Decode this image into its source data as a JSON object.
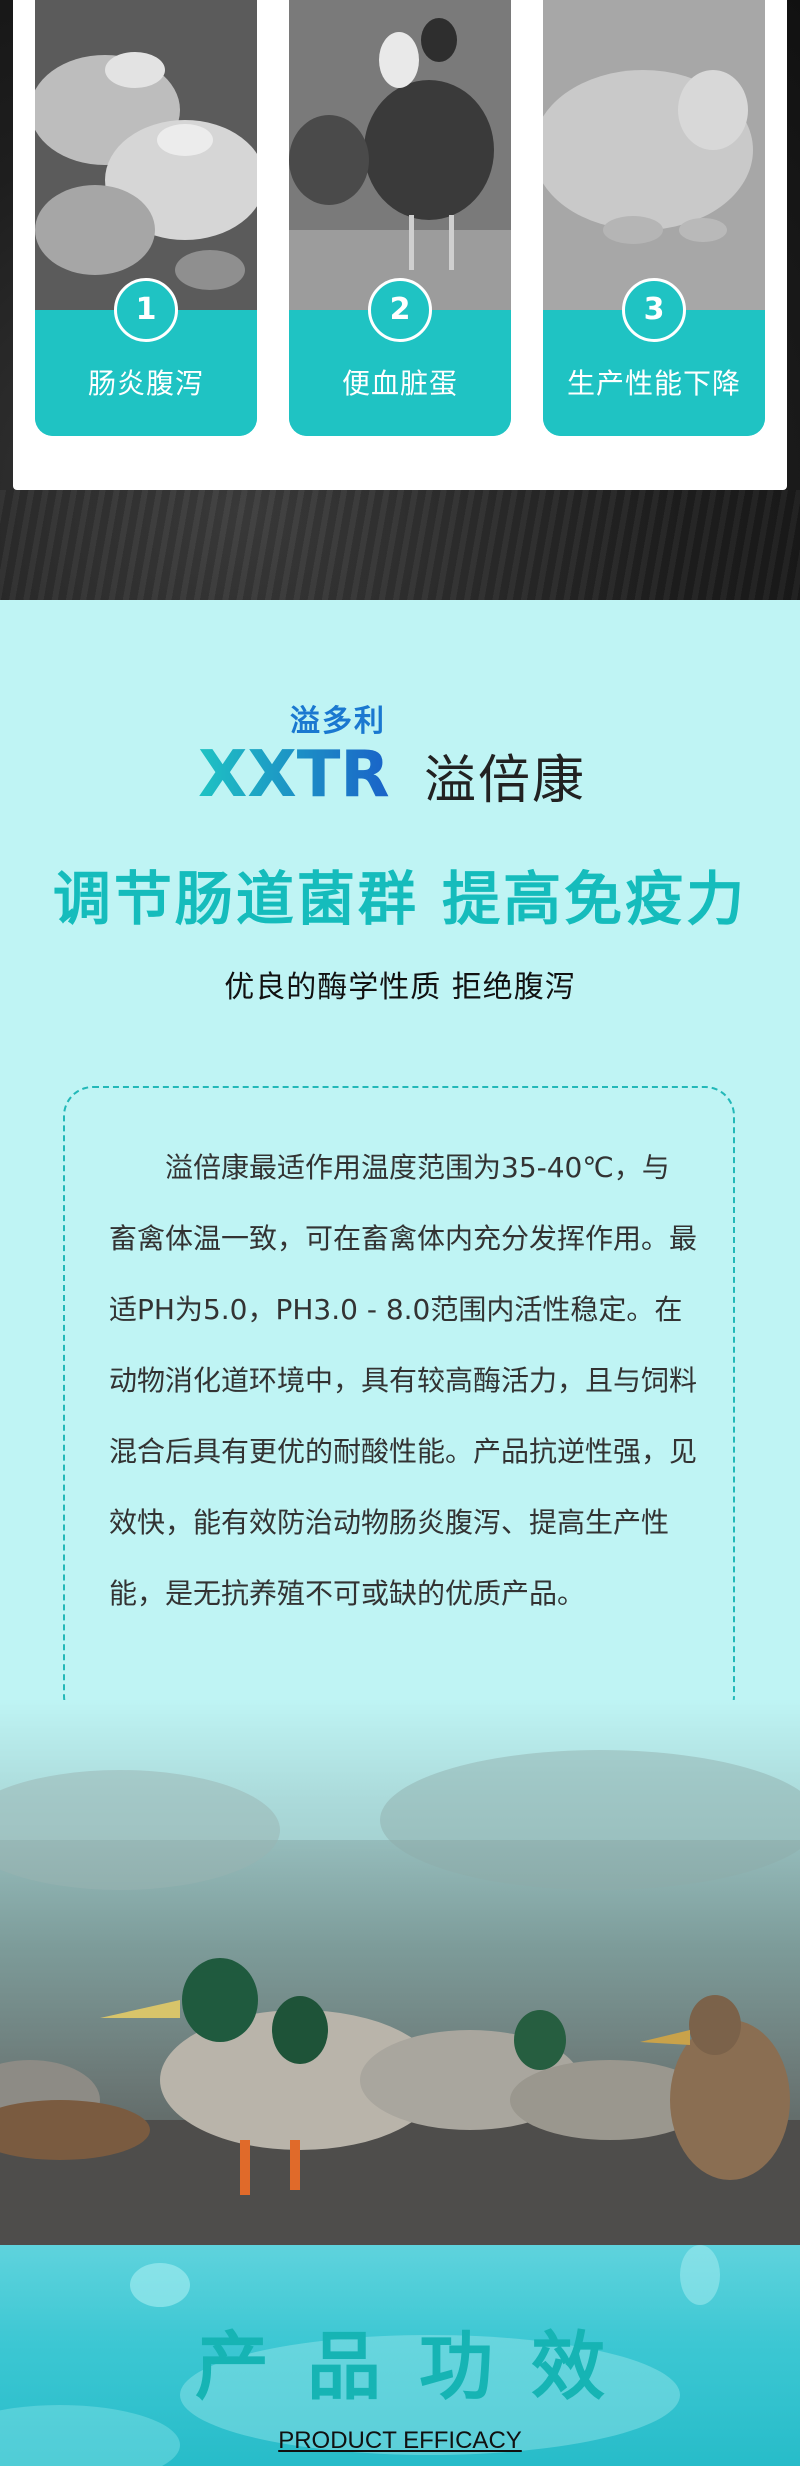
{
  "symptoms": [
    {
      "number": "1",
      "label": "肠炎腹泻",
      "photo": "piglets-photo"
    },
    {
      "number": "2",
      "label": "便血脏蛋",
      "photo": "hens-photo"
    },
    {
      "number": "3",
      "label": "生产性能下降",
      "photo": "sick-pig-photo"
    }
  ],
  "brand": {
    "small_name": "溢多利",
    "mark_text": "XXTR",
    "product_name": "溢倍康"
  },
  "headline": "调节肠道菌群 提高免疫力",
  "subheadline": "优良的酶学性质 拒绝腹泻",
  "description": "溢倍康最适作用温度范围为35-40℃，与畜禽体温一致，可在畜禽体内充分发挥作用。最适PH为5.0，PH3.0 - 8.0范围内活性稳定。在动物消化道环境中，具有较高酶活力，且与饲料混合后具有更优的耐酸性能。产品抗逆性强，见效快，能有效防治动物肠炎腹泻、提高生产性能，是无抗养殖不可或缺的优质产品。",
  "efficacy": {
    "title": "产品功效",
    "subtitle": "PRODUCT EFFICACY"
  },
  "colors": {
    "teal": "#1fc3c3",
    "headline_teal": "#15bcbc",
    "background": "#bff4f4",
    "brand_blue": "#1a78d0"
  }
}
